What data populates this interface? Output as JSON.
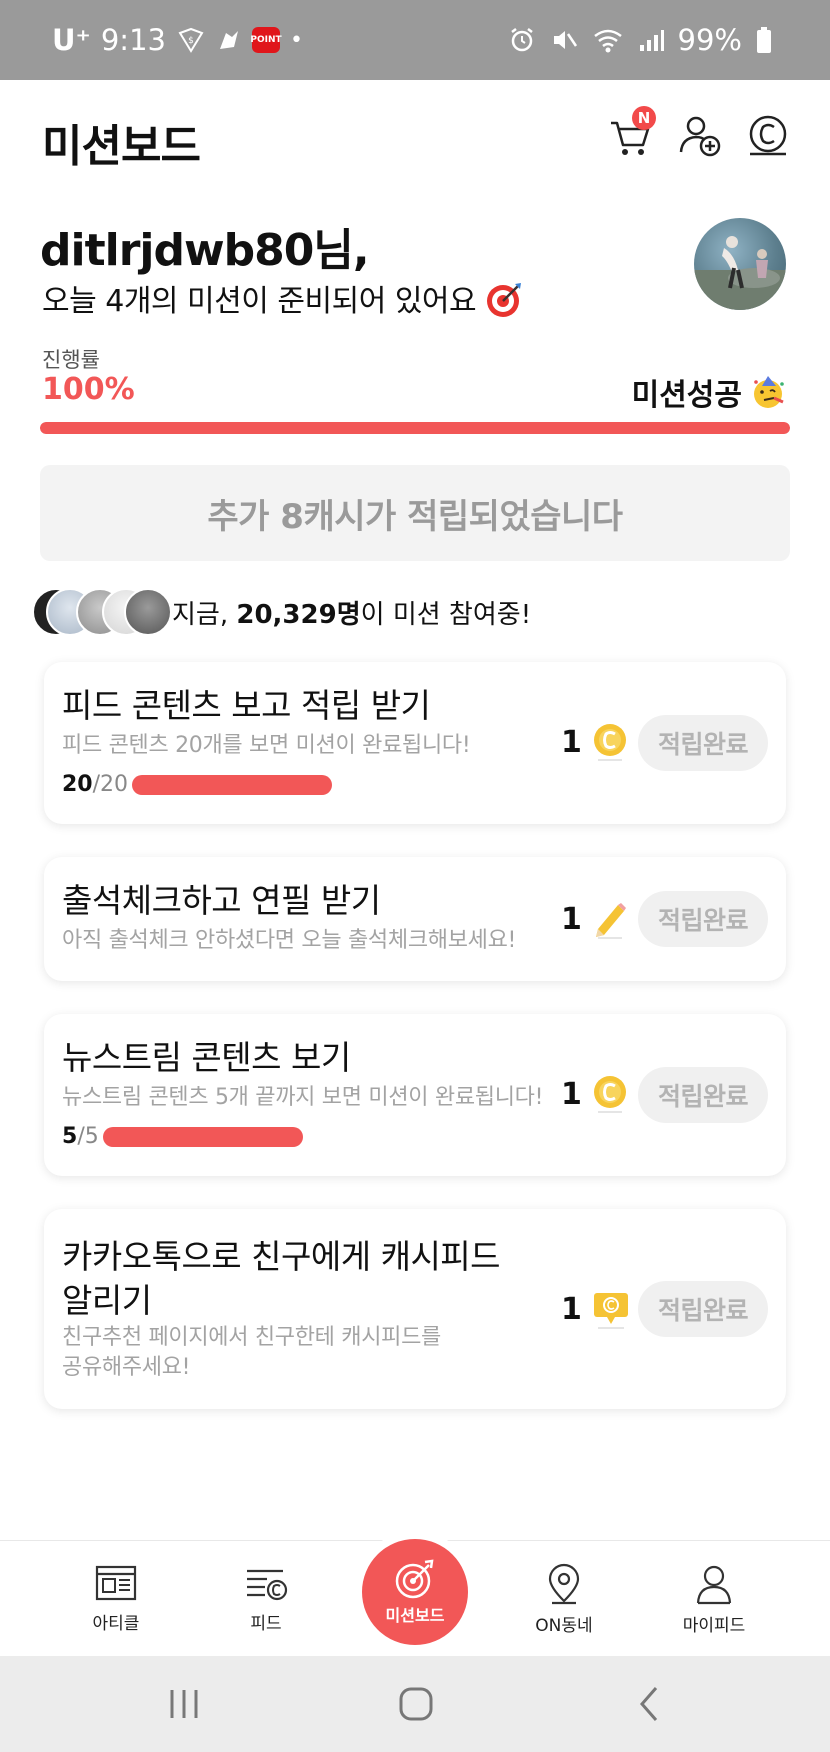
{
  "status_bar": {
    "carrier": "U⁺",
    "time": "9:13",
    "point_label": "POINT",
    "battery": "99%"
  },
  "header": {
    "title": "미션보드",
    "cart_badge": "N"
  },
  "greeting": {
    "name": "ditlrjdwb80님,",
    "subtitle": "오늘 4개의 미션이 준비되어 있어요"
  },
  "progress": {
    "label": "진행률",
    "percent_text": "100%",
    "percent": 100,
    "status": "미션성공"
  },
  "extra_cash_notice": "추가 8캐시가 적립되었습니다",
  "participants": {
    "prefix": "지금, ",
    "count": "20,329명",
    "suffix": "이 미션 참여중!"
  },
  "missions": [
    {
      "title": "피드 콘텐츠 보고 적립 받기",
      "desc": "피드 콘텐츠 20개를 보면 미션이 완료됩니다!",
      "progress_current": "20",
      "progress_total": "/20",
      "progress_fraction": 1.0,
      "reward_amount": "1",
      "reward_icon": "coin-icon",
      "button": "적립완료"
    },
    {
      "title": "출석체크하고 연필 받기",
      "desc": "아직 출석체크 안하셨다면 오늘 출석체크해보세요!",
      "reward_amount": "1",
      "reward_icon": "pencil-icon",
      "button": "적립완료"
    },
    {
      "title": "뉴스트림 콘텐츠 보기",
      "desc": "뉴스트림 콘텐츠 5개 끝까지 보면 미션이 완료됩니다!",
      "progress_current": "5",
      "progress_total": "/5",
      "progress_fraction": 1.0,
      "reward_amount": "1",
      "reward_icon": "coin-icon",
      "button": "적립완료"
    },
    {
      "title_line1": "카카오톡으로 친구에게 캐시피드",
      "title_line2": "알리기",
      "desc_line1": "친구추천 페이지에서 친구한테 캐시피드를",
      "desc_line2": "공유해주세요!",
      "reward_amount": "1",
      "reward_icon": "coupon-icon",
      "button": "적립완료"
    }
  ],
  "bottom_nav": {
    "items": [
      "아티클",
      "피드",
      "미션보드",
      "ON동네",
      "마이피드"
    ]
  },
  "colors": {
    "accent": "#f25757",
    "coin": "#f5c334",
    "muted_text": "#a3a3a3"
  }
}
